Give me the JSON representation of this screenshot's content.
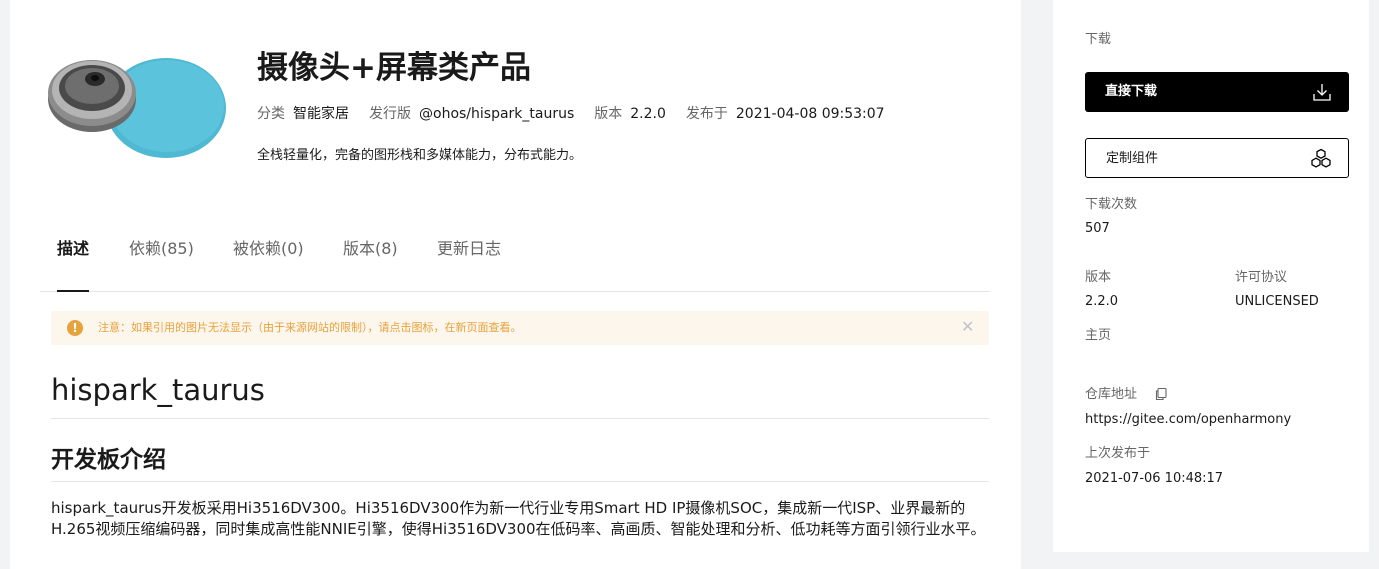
{
  "product": {
    "title": "摄像头+屏幕类产品",
    "meta": {
      "category_label": "分类",
      "category_value": "智能家居",
      "release_label": "发行版",
      "release_value": "@ohos/hispark_taurus",
      "version_label": "版本",
      "version_value": "2.2.0",
      "published_label": "发布于",
      "published_value": "2021-04-08 09:53:07"
    },
    "description": "全栈轻量化，完备的图形栈和多媒体能力，分布式能力。"
  },
  "tabs": [
    {
      "label": "描述",
      "active": true
    },
    {
      "label": "依赖(85)",
      "active": false
    },
    {
      "label": "被依赖(0)",
      "active": false
    },
    {
      "label": "版本(8)",
      "active": false
    },
    {
      "label": "更新日志",
      "active": false
    }
  ],
  "notice": {
    "icon": "warning-icon",
    "text": "注意：如果引用的图片无法显示（由于来源网站的限制），请点击图标，在新页面查看。",
    "close_icon": "close-icon"
  },
  "readme": {
    "h1": "hispark_taurus",
    "h2": "开发板介绍",
    "paragraph": "hispark_taurus开发板采用Hi3516DV300。Hi3516DV300作为新一代行业专用Smart HD IP摄像机SOC，集成新一代ISP、业界最新的H.265视频压缩编码器，同时集成高性能NNIE引擎，使得Hi3516DV300在低码率、高画质、智能处理和分析、低功耗等方面引领行业水平。"
  },
  "sidebar": {
    "download_heading": "下载",
    "direct_download_label": "直接下载",
    "direct_download_icon": "download-icon",
    "custom_component_label": "定制组件",
    "custom_component_icon": "cubes-icon",
    "downloads_label": "下载次数",
    "downloads_value": "507",
    "version_label": "版本",
    "version_value": "2.2.0",
    "license_label": "许可协议",
    "license_value": "UNLICENSED",
    "homepage_label": "主页",
    "repo_label": "仓库地址",
    "repo_copy_icon": "copy-icon",
    "repo_value": "https://gitee.com/openharmony",
    "last_published_label": "上次发布于",
    "last_published_value": "2021-07-06 10:48:17"
  },
  "colors": {
    "accent": "#000000",
    "notice_bg": "#fdf6ec",
    "notice_text": "#e6a23c",
    "product_disc": "#5bc4dc",
    "page_bg": "#f2f3f5"
  }
}
